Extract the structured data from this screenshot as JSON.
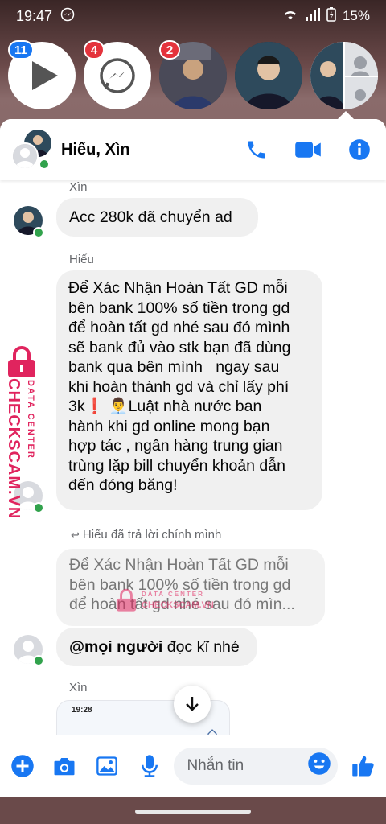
{
  "status": {
    "time": "19:47",
    "battery": "15%"
  },
  "chat_heads": [
    {
      "name": "video-head",
      "badge": "11"
    },
    {
      "name": "messenger-head",
      "badge": "4"
    },
    {
      "name": "contact-head-1",
      "badge": "2"
    },
    {
      "name": "contact-head-2",
      "badge": ""
    },
    {
      "name": "contact-head-3",
      "badge": ""
    }
  ],
  "header": {
    "title": "Hiếu, Xìn"
  },
  "messages": {
    "sender_1": "Xìn",
    "msg_1": "Acc 280k đã chuyển ad",
    "sender_2": "Hiếu",
    "msg_2_lines": [
      "Để Xác Nhận Hoàn Tất GD mỗi",
      "bên bank 100% số tiền trong gd",
      "để hoàn tất gd nhé sau đó mình",
      "sẽ bank đủ vào stk bạn đã dùng",
      "bank qua bên mình   ngay sau",
      "khi hoàn thành gd và chỉ lấy phí",
      "3k❗ 👨‍💼Luật nhà nước ban",
      "hành khi gd online mong bạn",
      "hợp tác , ngân hàng trung gian",
      "trùng lặp bill chuyển khoản dẫn",
      "đến đóng băng!"
    ],
    "reply_note": "Hiếu đã trả lời chính mình",
    "quoted_lines": [
      "Để Xác Nhận Hoàn Tất GD mỗi",
      "bên bank 100% số tiền trong gd",
      "để hoàn tất gd nhé sau đó mìn..."
    ],
    "msg_3_mention": "@mọi người",
    "msg_3_rest": " đọc kĩ nhé",
    "sender_3": "Xìn",
    "preview_time": "19:28"
  },
  "composer": {
    "placeholder": "Nhắn tin"
  },
  "watermark": {
    "side_line_1": "DATA CENTER",
    "side_line_2": "CHECKSCAM.VN",
    "center_line_1": "DATA CENTER",
    "center_line_2": "CHECKSCAM.VN"
  },
  "colors": {
    "accent": "#1877f2",
    "online": "#31a24c",
    "badge": "#e4333c",
    "watermark": "#e0245e"
  }
}
